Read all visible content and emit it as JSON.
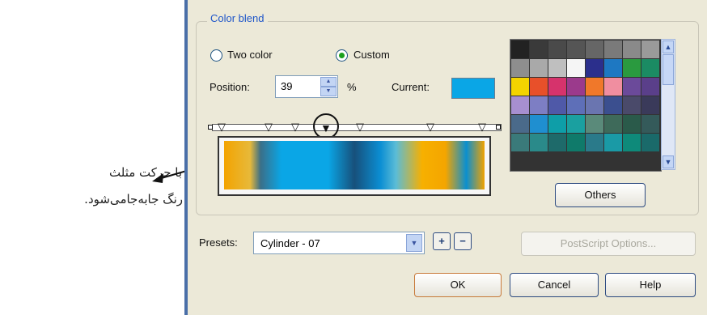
{
  "annotation": {
    "line1": "با حرکت مثلث",
    "line2": "رنگ جابه‌جامی‌شود."
  },
  "dialog": {
    "group_title": "Color blend",
    "radio_two_color": "Two color",
    "radio_custom": "Custom",
    "selected_mode": "Custom",
    "position_label": "Position:",
    "position_value": "39",
    "percent_unit": "%",
    "current_label": "Current:",
    "current_color": "#0aa6e6",
    "others_button": "Others",
    "presets_label": "Presets:",
    "presets_value": "Cylinder - 07",
    "postscript_button": "PostScript Options...",
    "ok_button": "OK",
    "cancel_button": "Cancel",
    "help_button": "Help"
  },
  "palette_colors": [
    "#222222",
    "#3a3a3a",
    "#4a4a4a",
    "#555555",
    "#666666",
    "#7a7a7a",
    "#8a8a8a",
    "#9a9a9a",
    "#8e8e8e",
    "#a9a9a9",
    "#bfbfbf",
    "#f5f5f5",
    "#2b2f8c",
    "#1e78c2",
    "#2a9a3f",
    "#1b8b63",
    "#f4d400",
    "#e8502a",
    "#d6336c",
    "#9b3a8c",
    "#f0782a",
    "#f08ea0",
    "#6b4a9a",
    "#5a3f8a",
    "#a78fd0",
    "#7d7ec4",
    "#4f59a8",
    "#5e6fb8",
    "#6a75b0",
    "#3b4f8f",
    "#4a4a6a",
    "#3a3a5a",
    "#4a6a8a",
    "#1f8fd0",
    "#0e9ea8",
    "#1aa0a0",
    "#5a8a7a",
    "#3e6a5a",
    "#2a5a4a",
    "#345a5a",
    "#3a7a7a",
    "#2a8a8a",
    "#1e6a6a",
    "#0f7a6a",
    "#2a7a8a",
    "#1a9aa6",
    "#0e8a7a",
    "#1a6a6a"
  ],
  "icons": {
    "spin_up": "▲",
    "spin_down": "▼",
    "dropdown": "▼",
    "scroll_up": "▲",
    "scroll_down": "▼",
    "add_preset": "+",
    "remove_preset": "−",
    "arrow": "arrow-left"
  }
}
